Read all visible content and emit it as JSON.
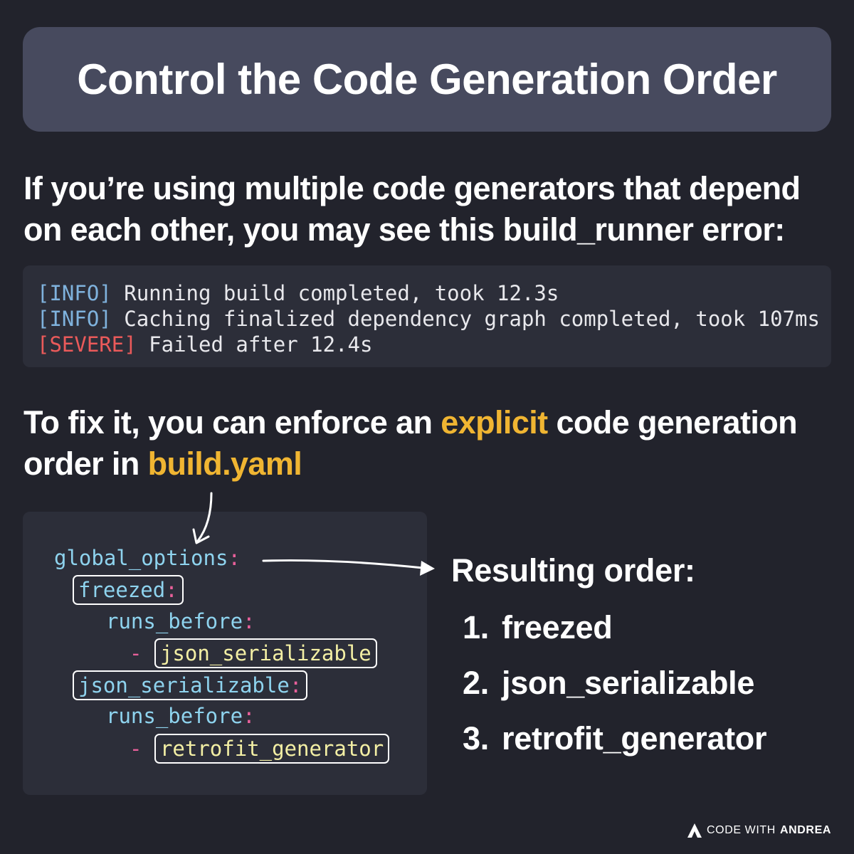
{
  "title": "Control the Code Generation Order",
  "intro": "If you’re using multiple code generators that depend on each other, you may see this build_runner error:",
  "log": [
    {
      "tag": "[INFO]",
      "level": "info",
      "message": "Running build completed, took 12.3s"
    },
    {
      "tag": "[INFO]",
      "level": "info",
      "message": "Caching finalized dependency graph completed, took 107ms"
    },
    {
      "tag": "[SEVERE]",
      "level": "severe",
      "message": "Failed after 12.4s"
    }
  ],
  "fix": {
    "before": "To fix it, you can enforce an ",
    "highlight1": "explicit",
    "middle": " code generation order in ",
    "highlight2": "build.yaml"
  },
  "code": {
    "global_options": "global_options",
    "builder1": "freezed",
    "runs_before": "runs_before",
    "dash": "-",
    "builder1_target": "json_serializable",
    "builder2": "json_serializable",
    "builder2_target": "retrofit_generator",
    "colon": ":"
  },
  "result": {
    "title": "Resulting order:",
    "items": [
      {
        "num": "1.",
        "label": "freezed"
      },
      {
        "num": "2.",
        "label": "json_serializable"
      },
      {
        "num": "3.",
        "label": "retrofit_generator"
      }
    ]
  },
  "brand": {
    "left": "CODE WITH",
    "right": "ANDREA",
    "icon": "andrea-logo-icon"
  },
  "colors": {
    "background": "#22232c",
    "title_box": "#474a5e",
    "highlight": "#f0b532",
    "info": "#7fb2dd",
    "severe": "#ea5a5a",
    "code_key": "#8ed3ee",
    "code_colon": "#e8609a",
    "code_value": "#f3efa4"
  }
}
